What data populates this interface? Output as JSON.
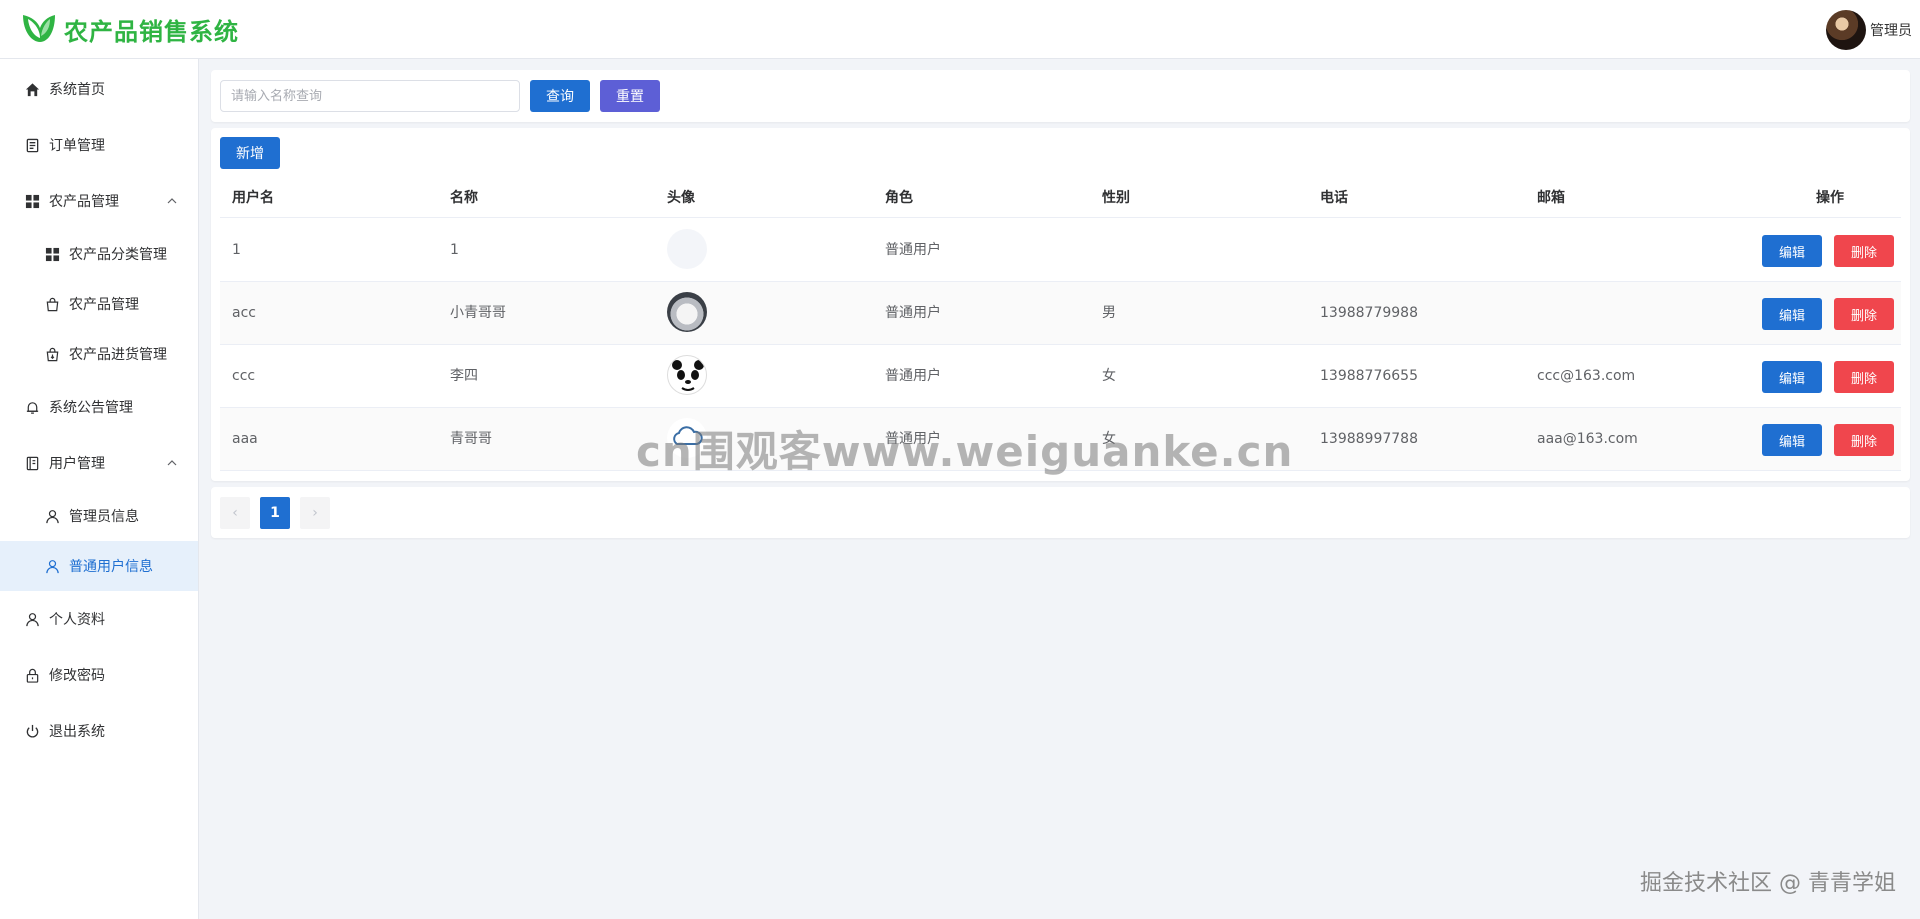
{
  "app": {
    "title": "农产品销售系统",
    "brand_color": "#2fb443"
  },
  "header": {
    "user_name": "管理员"
  },
  "sidebar": {
    "items": [
      {
        "label": "系统首页",
        "icon": "home-icon"
      },
      {
        "label": "订单管理",
        "icon": "document-icon"
      },
      {
        "label": "农产品管理",
        "icon": "grid-icon",
        "expanded": true
      },
      {
        "label": "农产品分类管理",
        "icon": "grid-icon"
      },
      {
        "label": "农产品管理",
        "icon": "bag-icon"
      },
      {
        "label": "农产品进货管理",
        "icon": "bag-import-icon"
      },
      {
        "label": "系统公告管理",
        "icon": "bell-icon"
      },
      {
        "label": "用户管理",
        "icon": "notebook-icon",
        "expanded": true
      },
      {
        "label": "管理员信息",
        "icon": "user-icon"
      },
      {
        "label": "普通用户信息",
        "icon": "user-icon",
        "active": true
      },
      {
        "label": "个人资料",
        "icon": "user-icon"
      },
      {
        "label": "修改密码",
        "icon": "lock-icon"
      },
      {
        "label": "退出系统",
        "icon": "power-icon"
      }
    ]
  },
  "search": {
    "placeholder": "请输入名称查询",
    "value": "",
    "query_label": "查询",
    "reset_label": "重置"
  },
  "toolbar": {
    "add_label": "新增"
  },
  "table": {
    "columns": [
      "用户名",
      "名称",
      "头像",
      "角色",
      "性别",
      "电话",
      "邮箱",
      "操作"
    ],
    "rows": [
      {
        "username": "1",
        "name": "1",
        "avatar": "blank-avatar",
        "role": "普通用户",
        "gender": "",
        "phone": "",
        "email": ""
      },
      {
        "username": "acc",
        "name": "小青哥哥",
        "avatar": "dog-photo-avatar",
        "role": "普通用户",
        "gender": "男",
        "phone": "13988779988",
        "email": ""
      },
      {
        "username": "ccc",
        "name": "李四",
        "avatar": "panda-avatar",
        "role": "普通用户",
        "gender": "女",
        "phone": "13988776655",
        "email": "ccc@163.com"
      },
      {
        "username": "aaa",
        "name": "青哥哥",
        "avatar": "cloud-avatar",
        "role": "普通用户",
        "gender": "女",
        "phone": "13988997788",
        "email": "aaa@163.com"
      }
    ],
    "edit_label": "编辑",
    "delete_label": "删除"
  },
  "pagination": {
    "current": "1",
    "prev_symbol": "‹",
    "next_symbol": "›"
  },
  "overlays": {
    "watermark": "cn围观客www.weiguanke.cn",
    "footer": "掘金技术社区 @ 青青学姐"
  }
}
